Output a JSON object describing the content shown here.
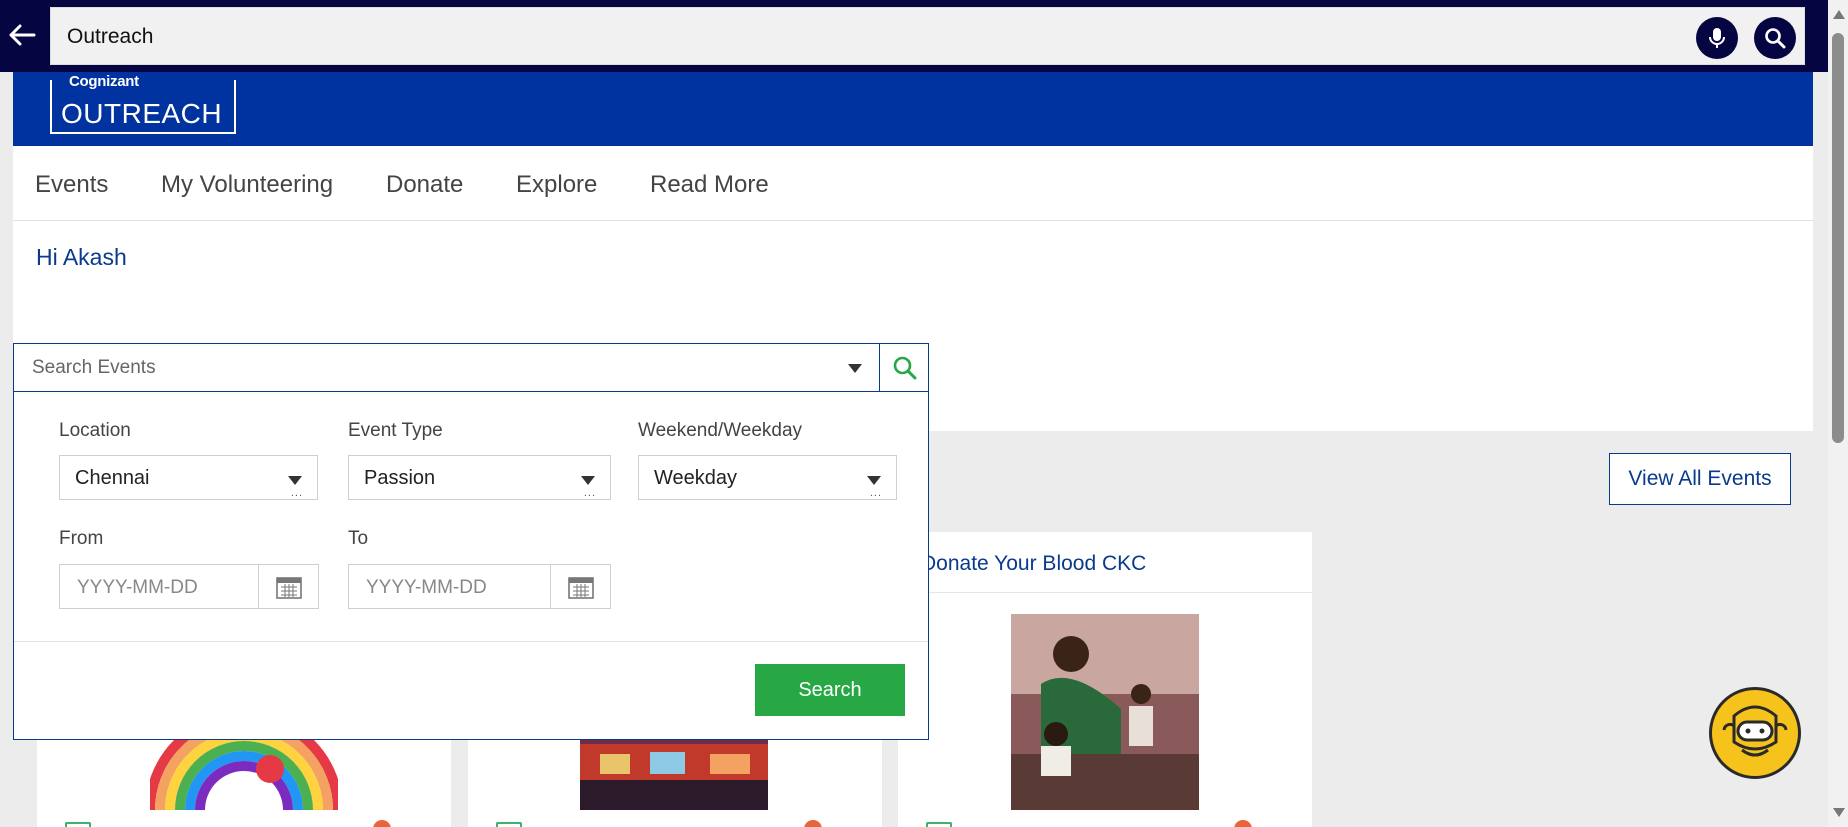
{
  "browser_search": {
    "value": "Outreach"
  },
  "brand": {
    "logo_top": "Cognizant",
    "logo_main": "OUTREACH"
  },
  "nav": {
    "items": [
      {
        "label": "Events"
      },
      {
        "label": "My Volunteering"
      },
      {
        "label": "Donate"
      },
      {
        "label": "Explore"
      },
      {
        "label": "Read More"
      }
    ]
  },
  "greeting": "Hi Akash",
  "event_search": {
    "placeholder": "Search Events",
    "location": {
      "label": "Location",
      "value": "Chennai"
    },
    "event_type": {
      "label": "Event Type",
      "value": "Passion"
    },
    "week": {
      "label": "Weekend/Weekday",
      "value": "Weekday"
    },
    "from": {
      "label": "From",
      "placeholder": "YYYY-MM-DD"
    },
    "to": {
      "label": "To",
      "placeholder": "YYYY-MM-DD"
    },
    "submit": "Search"
  },
  "view_all": "View All Events",
  "cards": [
    {
      "title": ""
    },
    {
      "title": ""
    },
    {
      "title": "Donate Your Blood CKC"
    }
  ],
  "colors": {
    "brand": "#0033a0",
    "topbar": "#050542",
    "accent_green": "#28a745",
    "link": "#0a3a8c",
    "chatbot": "#f6c31c"
  }
}
